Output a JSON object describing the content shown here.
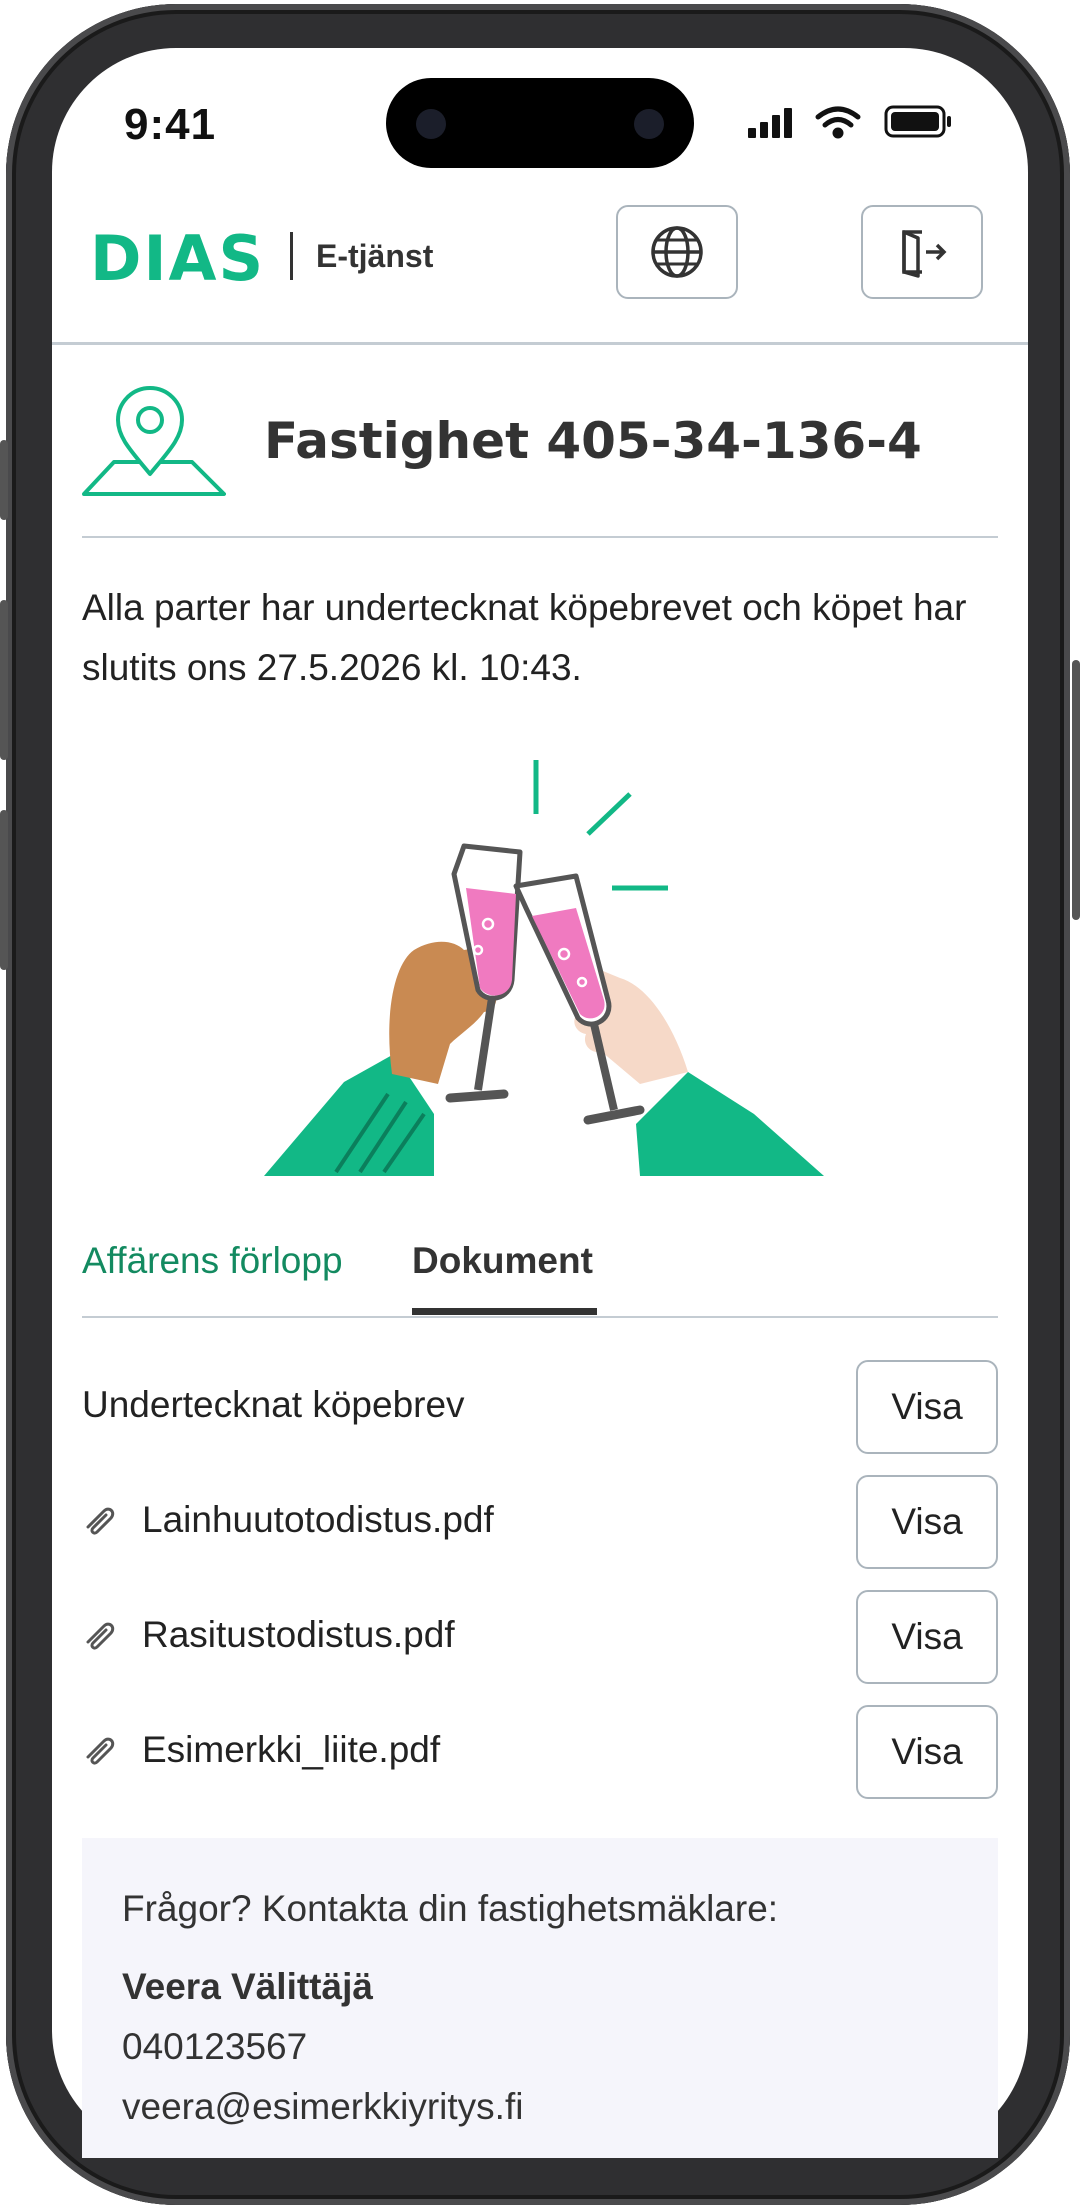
{
  "status_bar": {
    "time": "9:41"
  },
  "header": {
    "logo": "DIAS",
    "service": "E-tjänst",
    "language_icon": "globe-icon",
    "logout_icon": "logout-icon"
  },
  "property": {
    "title": "Fastighet 405-34-136-4",
    "icon": "location-pin-icon"
  },
  "message": "Alla parter har undertecknat köpebrevet och köpet har slutits ons 27.5.2026 kl. 10:43.",
  "tabs": [
    {
      "label": "Affärens förlopp",
      "active": false
    },
    {
      "label": "Dokument",
      "active": true
    }
  ],
  "documents": [
    {
      "name": "Undertecknat köpebrev",
      "attachment": false,
      "button": "Visa"
    },
    {
      "name": "Lainhuutotodistus.pdf",
      "attachment": true,
      "button": "Visa"
    },
    {
      "name": "Rasitustodistus.pdf",
      "attachment": true,
      "button": "Visa"
    },
    {
      "name": "Esimerkki_liite.pdf",
      "attachment": true,
      "button": "Visa"
    }
  ],
  "contact": {
    "question": "Frågor? Kontakta din fastighetsmäklare:",
    "name": "Veera Välittäjä",
    "phone": "040123567",
    "email": "veera@esimerkkiyritys.fi"
  },
  "colors": {
    "brand_green": "#12b886",
    "tab_green": "#138a60",
    "champagne_pink": "#f07ac0",
    "contact_bg": "#f5f5fb"
  }
}
